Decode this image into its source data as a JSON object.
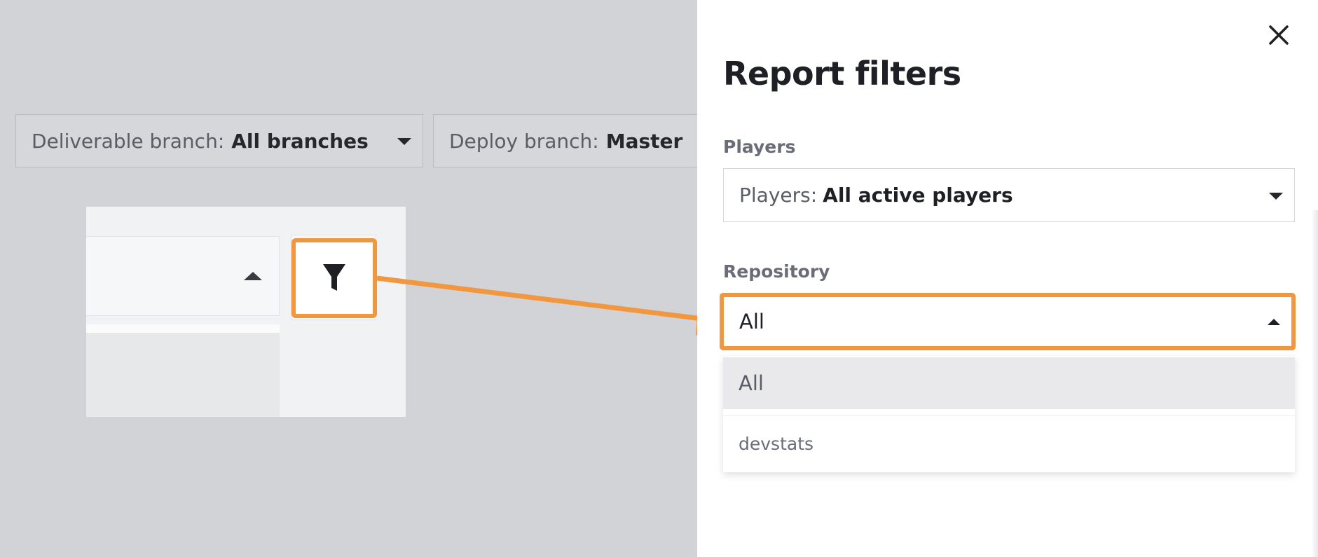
{
  "background": {
    "deliverable_branch": {
      "label": "Deliverable branch:",
      "value": "All branches"
    },
    "deploy_branch": {
      "label": "Deploy branch:",
      "value": "Master"
    }
  },
  "icons": {
    "filter": "funnel-icon",
    "close": "close-icon",
    "caret_down": "caret-down-icon",
    "caret_up": "caret-up-icon"
  },
  "colors": {
    "highlight": "#f0973f",
    "overlay": "#d2d3d7"
  },
  "panel": {
    "title": "Report filters",
    "players": {
      "label": "Players",
      "select_prefix": "Players:",
      "select_value": "All active players"
    },
    "repository": {
      "label": "Repository",
      "selected": "All",
      "options": [
        "All",
        "devstats"
      ]
    }
  }
}
